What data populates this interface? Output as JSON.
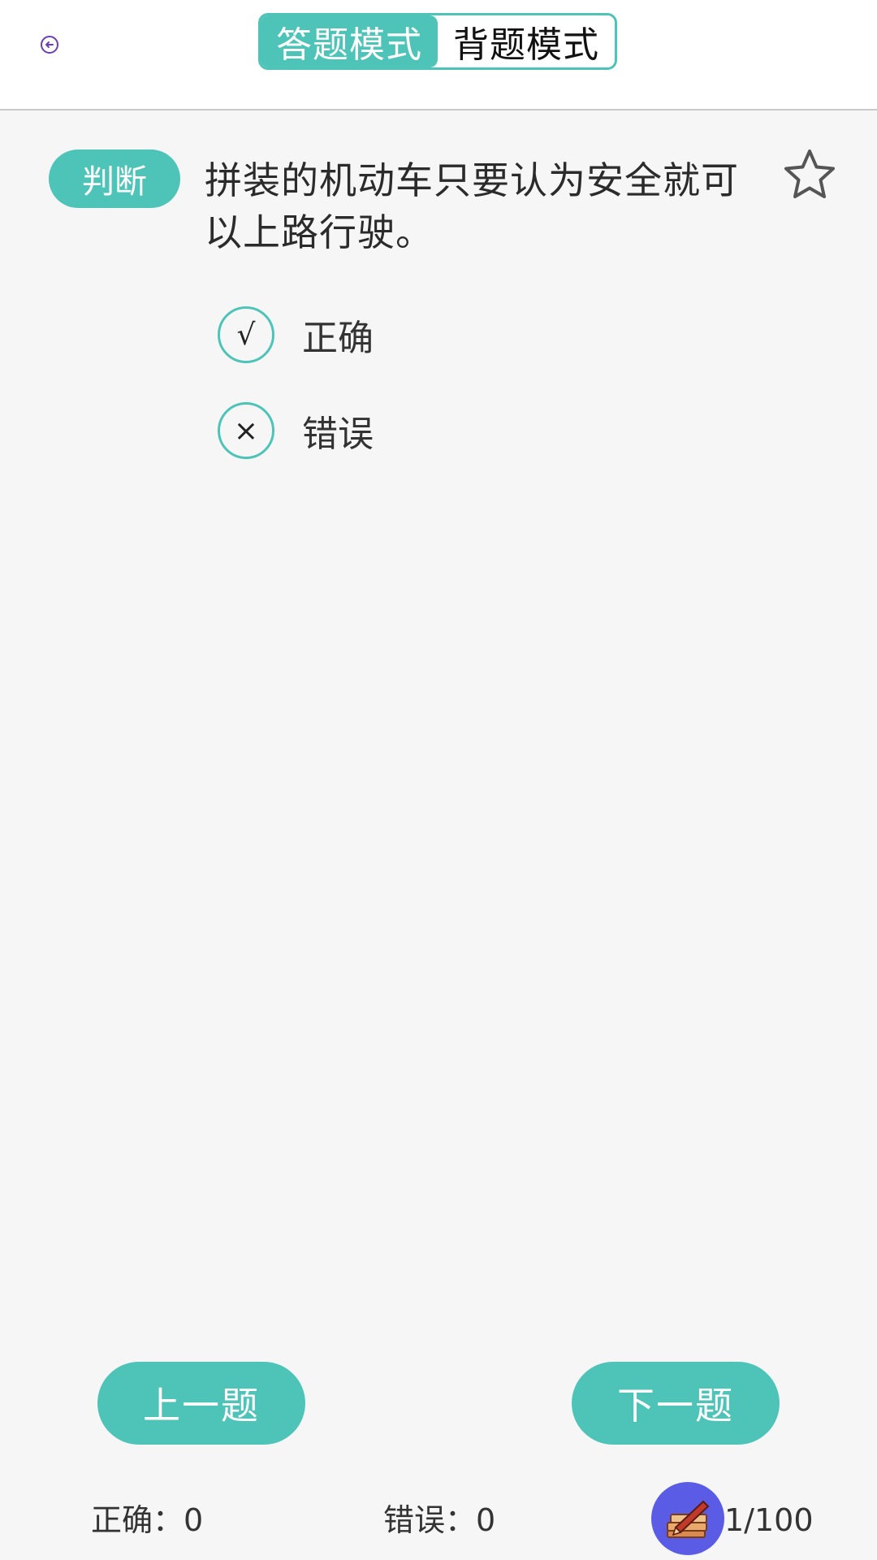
{
  "header": {
    "back_icon": "back-arrow-icon",
    "tabs": [
      {
        "label": "答题模式",
        "active": true
      },
      {
        "label": "背题模式",
        "active": false
      }
    ]
  },
  "question": {
    "type_badge": "判断",
    "text": "拼装的机动车只要认为安全就可以上路行驶。",
    "favorite_icon": "star-outline-icon",
    "options": [
      {
        "symbol": "√",
        "label": "正确"
      },
      {
        "symbol": "×",
        "label": "错误"
      }
    ]
  },
  "navigation": {
    "prev_label": "上一题",
    "next_label": "下一题"
  },
  "stats": {
    "correct": "正确：0",
    "wrong": "错误：0",
    "progress": "1/100"
  },
  "colors": {
    "accent": "#4ec4b8",
    "background": "#f6f6f6",
    "fab": "#5a5ce6"
  }
}
